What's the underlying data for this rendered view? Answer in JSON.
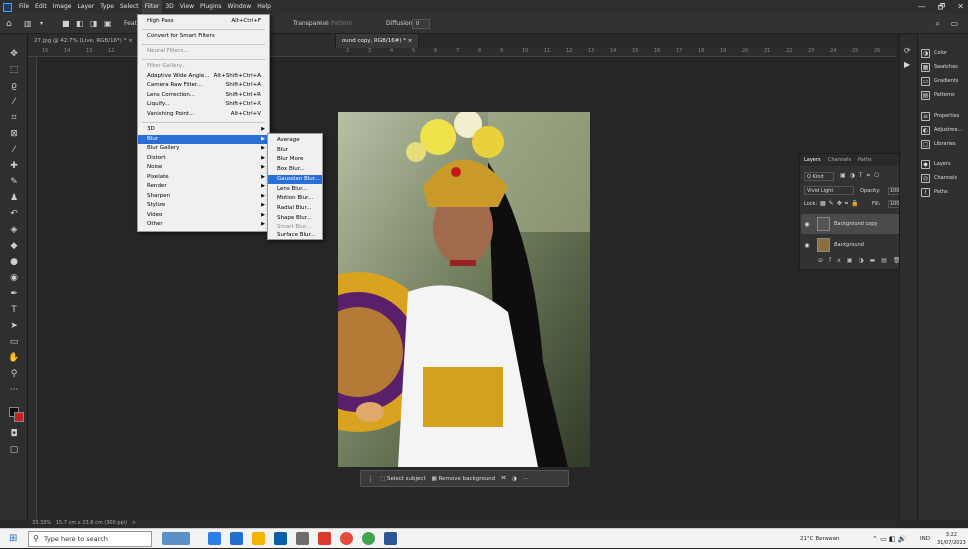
{
  "menubar": {
    "items": [
      "File",
      "Edit",
      "Image",
      "Layer",
      "Type",
      "Select",
      "Filter",
      "3D",
      "View",
      "Plugins",
      "Window",
      "Help"
    ],
    "window_controls": [
      "—",
      "🗗",
      "✕"
    ]
  },
  "options_bar": {
    "transparent_label": "Transparent",
    "use_pattern_label": "Use Pattern",
    "diffusion_label": "Diffusion:",
    "diffusion_value": "0",
    "feather_label": "Feat"
  },
  "tabs": [
    {
      "label": "27.jpg @ 42.7% (Live, RGB/16*) *",
      "close": "×"
    },
    {
      "label": "ound copy, RGB/16#) *",
      "close": "×"
    }
  ],
  "ruler_marks": [
    "15",
    "14",
    "13",
    "12",
    "11",
    "1",
    "2",
    "3",
    "4",
    "5",
    "6",
    "7",
    "8",
    "9",
    "10",
    "11",
    "12",
    "13",
    "14",
    "15",
    "16",
    "17",
    "18",
    "19",
    "20",
    "21",
    "22",
    "23",
    "24",
    "25",
    "26",
    "27"
  ],
  "filter_menu": {
    "items": [
      {
        "label": "High Pass",
        "shortcut": "Alt+Ctrl+F",
        "disabled": false
      },
      {
        "sep": true
      },
      {
        "label": "Convert for Smart Filters",
        "shortcut": "",
        "disabled": false
      },
      {
        "sep": true
      },
      {
        "label": "Neural Filters...",
        "shortcut": "",
        "disabled": true
      },
      {
        "sep": true
      },
      {
        "label": "Filter Gallery...",
        "shortcut": "",
        "disabled": true
      },
      {
        "label": "Adaptive Wide Angle...",
        "shortcut": "Alt+Shift+Ctrl+A",
        "disabled": false
      },
      {
        "label": "Camera Raw Filter...",
        "shortcut": "Shift+Ctrl+A",
        "disabled": false
      },
      {
        "label": "Lens Correction...",
        "shortcut": "Shift+Ctrl+R",
        "disabled": false
      },
      {
        "label": "Liquify...",
        "shortcut": "Shift+Ctrl+X",
        "disabled": false
      },
      {
        "label": "Vanishing Point...",
        "shortcut": "Alt+Ctrl+V",
        "disabled": false
      },
      {
        "sep": true
      },
      {
        "label": "3D",
        "submenu": true
      },
      {
        "label": "Blur",
        "submenu": true,
        "highlight": true
      },
      {
        "label": "Blur Gallery",
        "submenu": true
      },
      {
        "label": "Distort",
        "submenu": true
      },
      {
        "label": "Noise",
        "submenu": true
      },
      {
        "label": "Pixelate",
        "submenu": true
      },
      {
        "label": "Render",
        "submenu": true
      },
      {
        "label": "Sharpen",
        "submenu": true
      },
      {
        "label": "Stylize",
        "submenu": true
      },
      {
        "label": "Video",
        "submenu": true
      },
      {
        "label": "Other",
        "submenu": true
      }
    ]
  },
  "blur_menu": {
    "items": [
      {
        "label": "Average"
      },
      {
        "label": "Blur"
      },
      {
        "label": "Blur More"
      },
      {
        "label": "Box Blur..."
      },
      {
        "label": "Gaussian Blur...",
        "highlight": true
      },
      {
        "label": "Lens Blur..."
      },
      {
        "label": "Motion Blur..."
      },
      {
        "label": "Radial Blur..."
      },
      {
        "label": "Shape Blur..."
      },
      {
        "label": "Smart Blur...",
        "disabled": true
      },
      {
        "label": "Surface Blur..."
      }
    ]
  },
  "context_bar": {
    "select_subject": "Select subject",
    "remove_background": "Remove background",
    "more": "···"
  },
  "status": {
    "zoom": "33.33%",
    "doc": "15.7 cm x 23.8 cm (300 ppi)",
    "arrow": ">"
  },
  "layers_panel": {
    "tabs": [
      "Layers",
      "Channels",
      "Paths"
    ],
    "filter_label": "Q Kind",
    "blend_mode": "Vivid Light",
    "opacity_label": "Opacity:",
    "opacity_value": "100%",
    "lock_label": "Lock:",
    "fill_label": "Fill:",
    "fill_value": "100%",
    "layers": [
      {
        "name": "Background copy",
        "selected": true
      },
      {
        "name": "Background",
        "selected": false
      }
    ]
  },
  "right_panels": [
    {
      "label": "Color",
      "icon": "color-icon"
    },
    {
      "label": "Swatches",
      "icon": "swatches-icon"
    },
    {
      "label": "Gradients",
      "icon": "gradients-icon"
    },
    {
      "label": "Patterns",
      "icon": "patterns-icon"
    },
    {
      "label": "Properties",
      "icon": "properties-icon"
    },
    {
      "label": "Adjustme...",
      "icon": "adjustments-icon"
    },
    {
      "label": "Libraries",
      "icon": "libraries-icon"
    },
    {
      "label": "Layers",
      "icon": "layers-icon"
    },
    {
      "label": "Channels",
      "icon": "channels-icon"
    },
    {
      "label": "Paths",
      "icon": "paths-icon"
    }
  ],
  "taskbar": {
    "search_placeholder": "Type here to search",
    "weather": "21°C Berawan",
    "lang": "IND",
    "time": "3:22",
    "date": "31/07/2023"
  },
  "colors": {
    "accent": "#2a6fd6",
    "ps_blue": "#31a8ff"
  }
}
